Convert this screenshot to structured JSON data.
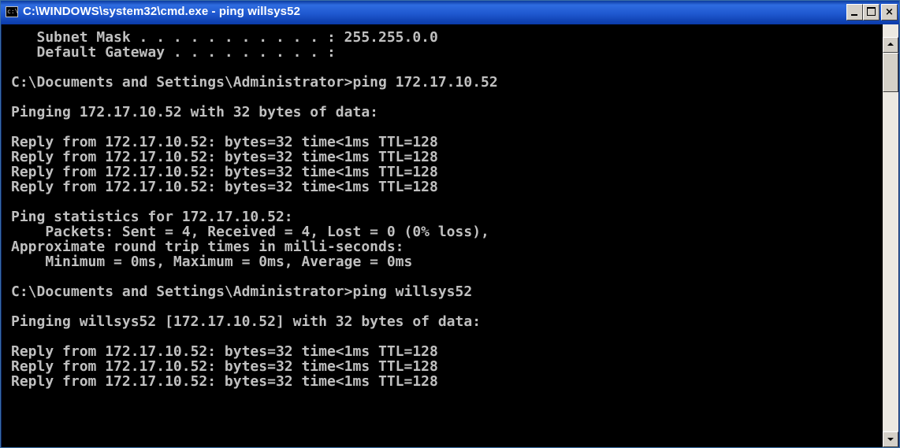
{
  "window": {
    "title": "C:\\WINDOWS\\system32\\cmd.exe - ping willsys52",
    "icon": "cmd-icon",
    "controls": [
      "minimize-icon",
      "maximize-icon",
      "close-icon"
    ],
    "close_label": "×"
  },
  "console": {
    "text_color": "#c0c0c0",
    "background": "#000000",
    "lines": [
      "   Subnet Mask . . . . . . . . . . . : 255.255.0.0",
      "   Default Gateway . . . . . . . . . :",
      "",
      "C:\\Documents and Settings\\Administrator>ping 172.17.10.52",
      "",
      "Pinging 172.17.10.52 with 32 bytes of data:",
      "",
      "Reply from 172.17.10.52: bytes=32 time<1ms TTL=128",
      "Reply from 172.17.10.52: bytes=32 time<1ms TTL=128",
      "Reply from 172.17.10.52: bytes=32 time<1ms TTL=128",
      "Reply from 172.17.10.52: bytes=32 time<1ms TTL=128",
      "",
      "Ping statistics for 172.17.10.52:",
      "    Packets: Sent = 4, Received = 4, Lost = 0 (0% loss),",
      "Approximate round trip times in milli-seconds:",
      "    Minimum = 0ms, Maximum = 0ms, Average = 0ms",
      "",
      "C:\\Documents and Settings\\Administrator>ping willsys52",
      "",
      "Pinging willsys52 [172.17.10.52] with 32 bytes of data:",
      "",
      "Reply from 172.17.10.52: bytes=32 time<1ms TTL=128",
      "Reply from 172.17.10.52: bytes=32 time<1ms TTL=128",
      "Reply from 172.17.10.52: bytes=32 time<1ms TTL=128"
    ]
  },
  "scrollbar": {
    "up_icon": "arrow-up-icon",
    "down_icon": "arrow-down-icon"
  }
}
